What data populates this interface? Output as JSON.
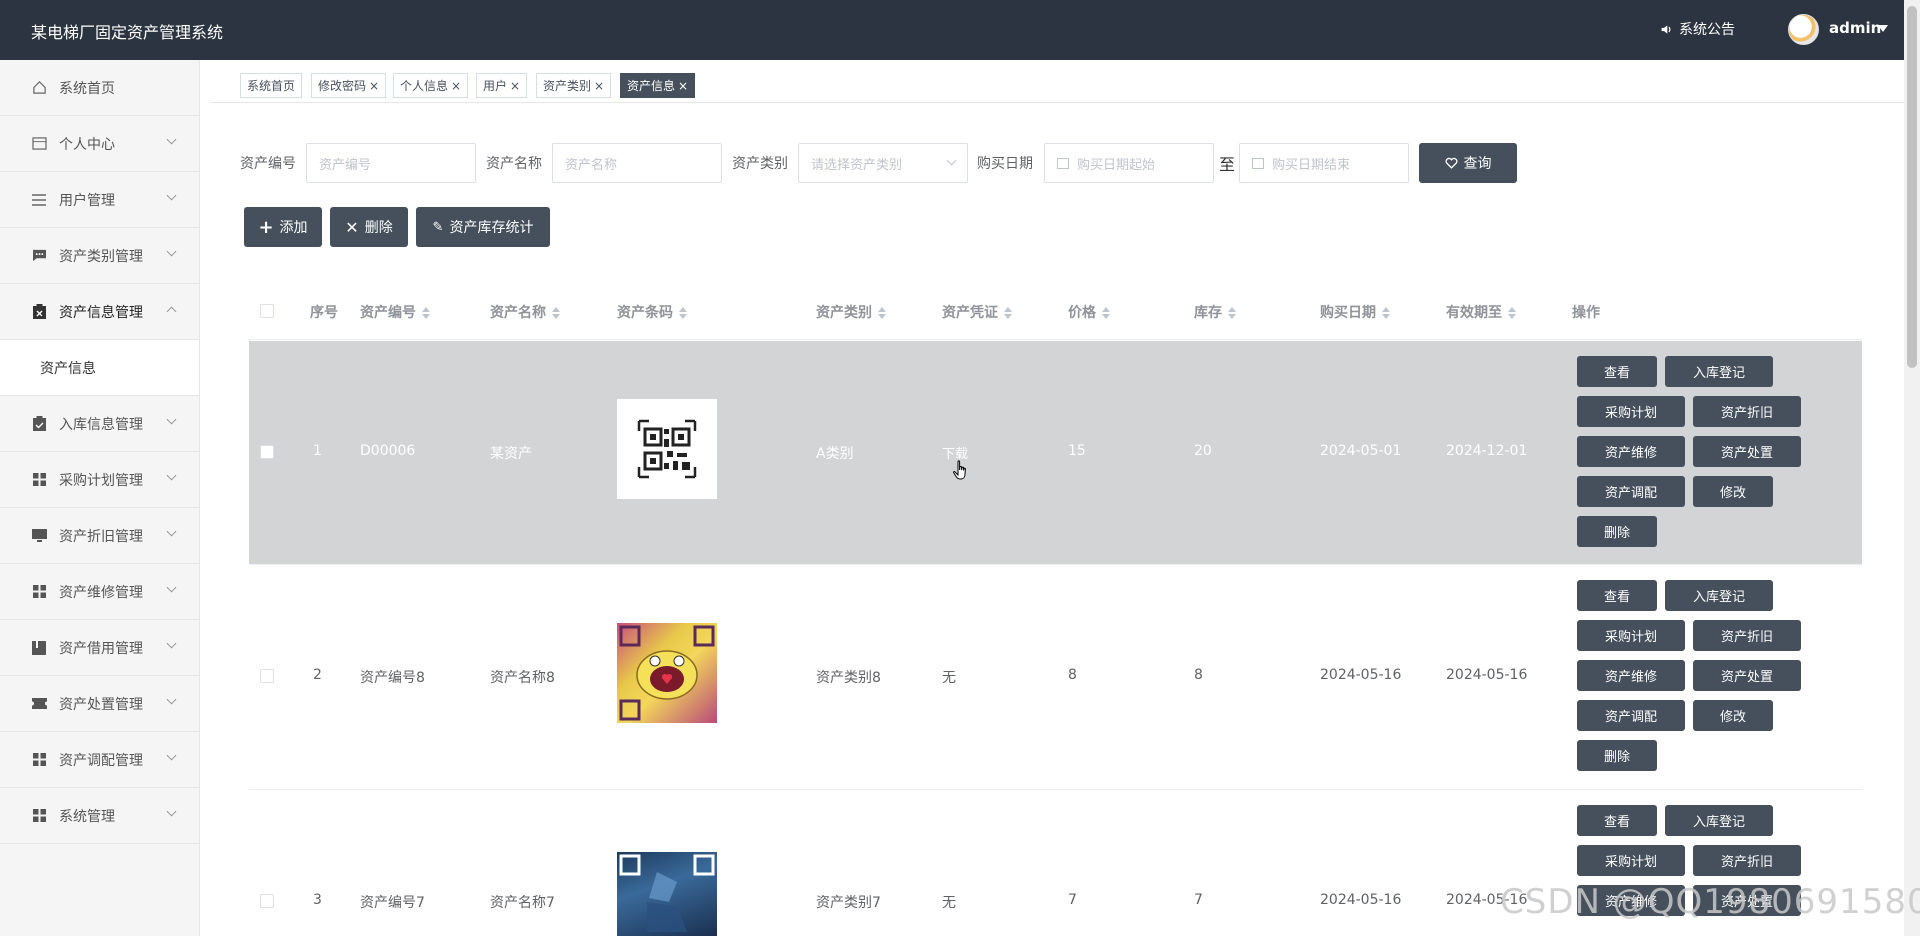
{
  "header": {
    "app_title": "某电梯厂固定资产管理系统",
    "notice_label": "系统公告",
    "user_name": "admin"
  },
  "sidebar": {
    "items": [
      {
        "label": "系统首页",
        "icon": "home-icon",
        "expandable": false
      },
      {
        "label": "个人中心",
        "icon": "card-icon",
        "expandable": true
      },
      {
        "label": "用户管理",
        "icon": "list-icon",
        "expandable": true
      },
      {
        "label": "资产类别管理",
        "icon": "chat-icon",
        "expandable": true
      },
      {
        "label": "资产信息管理",
        "icon": "clipboard-icon",
        "expandable": true,
        "expanded": true
      },
      {
        "label": "入库信息管理",
        "icon": "clipboard-check-icon",
        "expandable": true
      },
      {
        "label": "采购计划管理",
        "icon": "grid-icon",
        "expandable": true
      },
      {
        "label": "资产折旧管理",
        "icon": "monitor-icon",
        "expandable": true
      },
      {
        "label": "资产维修管理",
        "icon": "grid-icon",
        "expandable": true
      },
      {
        "label": "资产借用管理",
        "icon": "book-icon",
        "expandable": true
      },
      {
        "label": "资产处置管理",
        "icon": "ticket-icon",
        "expandable": true
      },
      {
        "label": "资产调配管理",
        "icon": "grid-icon",
        "expandable": true
      },
      {
        "label": "系统管理",
        "icon": "grid-icon",
        "expandable": true
      }
    ],
    "sub_item": "资产信息"
  },
  "tags": [
    {
      "label": "系统首页",
      "closable": false
    },
    {
      "label": "修改密码",
      "closable": true
    },
    {
      "label": "个人信息",
      "closable": true
    },
    {
      "label": "用户",
      "closable": true
    },
    {
      "label": "资产类别",
      "closable": true
    },
    {
      "label": "资产信息",
      "closable": true,
      "active": true
    }
  ],
  "search": {
    "code_label": "资产编号",
    "code_placeholder": "资产编号",
    "name_label": "资产名称",
    "name_placeholder": "资产名称",
    "category_label": "资产类别",
    "category_placeholder": "请选择资产类别",
    "date_label": "购买日期",
    "date_start_placeholder": "购买日期起始",
    "date_to": "至",
    "date_end_placeholder": "购买日期结束",
    "query_button": "查询"
  },
  "actions": {
    "add": "添加",
    "delete": "删除",
    "stats": "资产库存统计"
  },
  "table": {
    "columns": [
      "序号",
      "资产编号",
      "资产名称",
      "资产条码",
      "资产类别",
      "资产凭证",
      "价格",
      "库存",
      "购买日期",
      "有效期至",
      "操作"
    ],
    "rows": [
      {
        "index": "1",
        "code": "D00006",
        "name": "某资产",
        "category": "A类别",
        "voucher": "下载",
        "price": "15",
        "stock": "20",
        "buy_date": "2024-05-01",
        "valid_until": "2024-12-01"
      },
      {
        "index": "2",
        "code": "资产编号8",
        "name": "资产名称8",
        "category": "资产类别8",
        "voucher": "无",
        "price": "8",
        "stock": "8",
        "buy_date": "2024-05-16",
        "valid_until": "2024-05-16"
      },
      {
        "index": "3",
        "code": "资产编号7",
        "name": "资产名称7",
        "category": "资产类别7",
        "voucher": "无",
        "price": "7",
        "stock": "7",
        "buy_date": "2024-05-16",
        "valid_until": "2024-05-16"
      }
    ],
    "ops": [
      "查看",
      "入库登记",
      "采购计划",
      "资产折旧",
      "资产维修",
      "资产处置",
      "资产调配",
      "修改",
      "删除"
    ]
  },
  "watermark": "CSDN @QQ1980691580",
  "colors": {
    "header_bg": "#2b3440",
    "button_bg": "#45505c",
    "link_green": "#2ec77d",
    "hover_row": "#d3d4d6"
  }
}
